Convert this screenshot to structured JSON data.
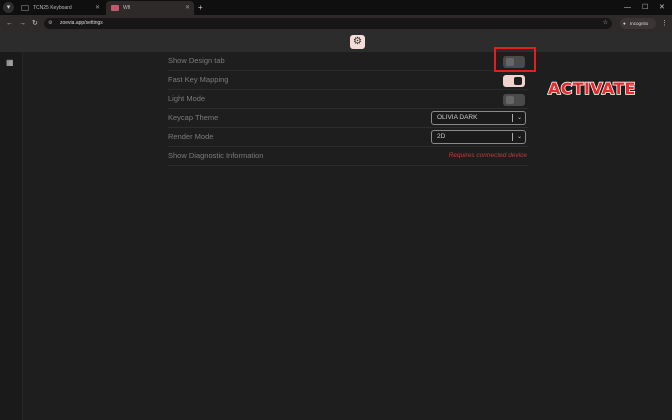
{
  "browser": {
    "tabs": [
      {
        "label": "TCN25 Keyboard",
        "active": false
      },
      {
        "label": "Wfl",
        "active": true
      }
    ],
    "url": "zoevia.app/settings",
    "incognito_label": "Incognito"
  },
  "settings": {
    "show_design_tab": {
      "label": "Show Design tab",
      "enabled": false
    },
    "fast_key_mapping": {
      "label": "Fast Key Mapping",
      "enabled": true
    },
    "light_mode": {
      "label": "Light Mode",
      "enabled": false
    },
    "keycap_theme": {
      "label": "Keycap Theme",
      "value": "OLIVIA DARK"
    },
    "render_mode": {
      "label": "Render Mode",
      "value": "2D"
    },
    "show_diagnostic": {
      "label": "Show Diagnostic Information",
      "warning": "Requires connected device"
    }
  },
  "annotation": {
    "text": "ACTIVATE",
    "color": "#e0201c"
  },
  "colors": {
    "accent": "#f0d3ce",
    "warning": "#c03a3a",
    "background": "#1e1e1e"
  }
}
